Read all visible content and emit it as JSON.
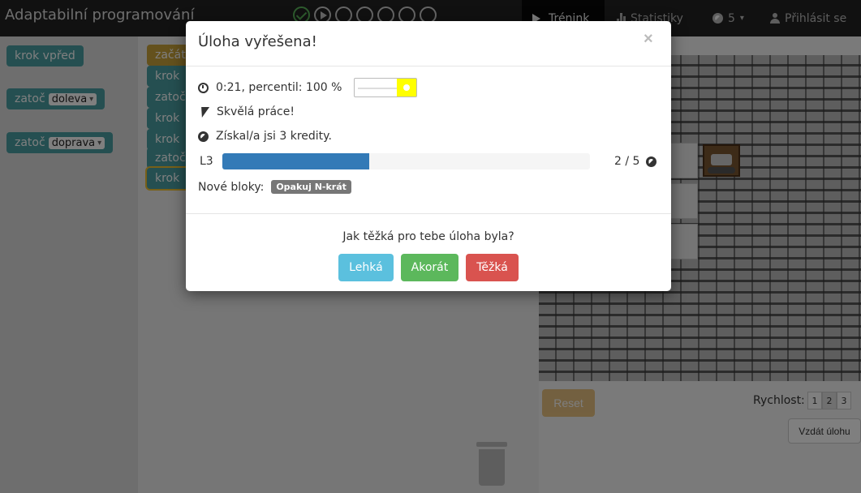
{
  "navbar": {
    "brand": "Adaptabilní programování",
    "tasks": [
      {
        "state": "solved"
      },
      {
        "state": "current"
      },
      {
        "state": "empty"
      },
      {
        "state": "empty"
      },
      {
        "state": "empty"
      },
      {
        "state": "empty"
      },
      {
        "state": "empty"
      }
    ],
    "training_label": "Trénink",
    "stats_label": "Statistiky",
    "credits": "5",
    "login_label": "Přihlásit se"
  },
  "toolbox": {
    "move_label": "krok vpřed",
    "turn_label": "zatoč",
    "left_option": "doleva",
    "right_option": "doprava"
  },
  "program": {
    "start_label": "začát",
    "blocks": [
      "krok",
      "zatoč",
      "krok",
      "krok",
      "zatoč",
      "krok"
    ]
  },
  "game": {
    "reset_label": "Reset",
    "speed_label": "Rychlost:",
    "speeds": [
      "1",
      "2",
      "3"
    ],
    "active_speed": "2",
    "giveup_label": "Vzdát úlohu"
  },
  "modal": {
    "title": "Úloha vyřešena!",
    "close": "×",
    "time_text": "0:21, percentil: 100 %",
    "praise": "Skvělá práce!",
    "credits_text": "Získal/a jsi 3 kredity.",
    "level_label": "L3",
    "level_progress": 0.4,
    "level_count": "2 / 5",
    "new_blocks_label": "Nové bloky:",
    "new_block": "Opakuj N-krát",
    "question": "Jak těžká pro tebe úloha byla?",
    "easy": "Lehká",
    "ok": "Akorát",
    "hard": "Těžká"
  },
  "colors": {
    "block_move": "#4a9ea2",
    "block_start": "#c9a23a",
    "level_fill": "#337ab7",
    "easy": "#5bc0de",
    "ok": "#5cb85c",
    "hard": "#d9534f",
    "flow_knob": "#ffff00"
  }
}
